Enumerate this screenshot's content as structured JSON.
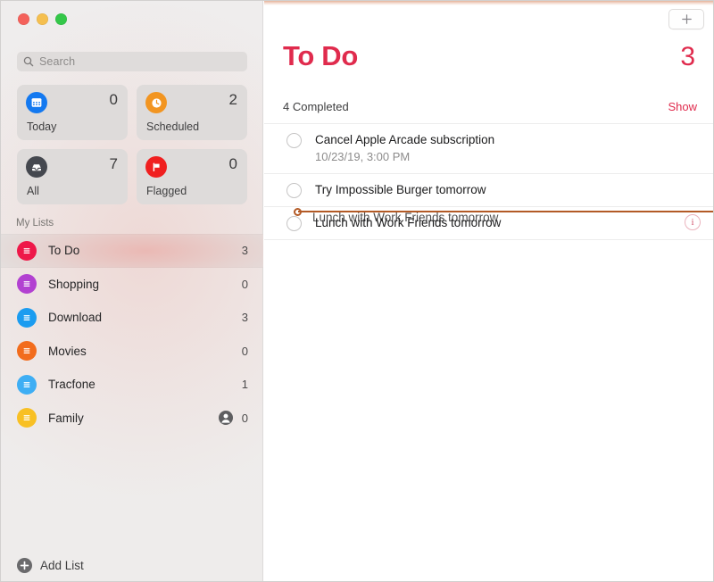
{
  "window": {
    "traffic_lights": [
      {
        "name": "close",
        "color": "#f4615b"
      },
      {
        "name": "minimize",
        "color": "#f5bf4f"
      },
      {
        "name": "zoom",
        "color": "#34c749"
      }
    ]
  },
  "sidebar": {
    "search": {
      "placeholder": "Search",
      "value": "",
      "icon": "search-icon"
    },
    "smart_lists": [
      {
        "label": "Today",
        "count": "0",
        "icon": "calendar-icon",
        "color": "#1479f0"
      },
      {
        "label": "Scheduled",
        "count": "2",
        "icon": "clock-icon",
        "color": "#f29521"
      },
      {
        "label": "All",
        "count": "7",
        "icon": "inbox-icon",
        "color": "#45484f"
      },
      {
        "label": "Flagged",
        "count": "0",
        "icon": "flag-icon",
        "color": "#f01f1f"
      }
    ],
    "my_lists_header": "My Lists",
    "lists": [
      {
        "label": "To Do",
        "count": "3",
        "color": "#ee1849",
        "selected": true,
        "shared": false
      },
      {
        "label": "Shopping",
        "count": "0",
        "color": "#b241d1",
        "selected": false,
        "shared": false
      },
      {
        "label": "Download",
        "count": "3",
        "color": "#1b9cf0",
        "selected": false,
        "shared": false
      },
      {
        "label": "Movies",
        "count": "0",
        "color": "#f26c1c",
        "selected": false,
        "shared": false
      },
      {
        "label": "Tracfone",
        "count": "1",
        "color": "#3eaef4",
        "selected": false,
        "shared": false
      },
      {
        "label": "Family",
        "count": "0",
        "color": "#f8c024",
        "selected": false,
        "shared": true
      }
    ],
    "add_list_label": "Add List"
  },
  "content": {
    "add_reminder_label": "+",
    "title": "To Do",
    "title_color": "#e02b4d",
    "count": "3",
    "completed_label": "4 Completed",
    "show_completed_label": "Show",
    "reminders": [
      {
        "title": "Cancel Apple Arcade subscription",
        "subtitle": "10/23/19, 3:00 PM",
        "completed": false,
        "info_badge": ""
      },
      {
        "title": "Try Impossible Burger tomorrow",
        "subtitle": "",
        "completed": false,
        "info_badge": ""
      },
      {
        "title": "Lunch with Work Friends tomorrow",
        "subtitle": "",
        "completed": false,
        "info_badge": "i"
      }
    ],
    "drag": {
      "ghost_text": "Lunch with Work Friends tomorrow",
      "indicator_color": "#b35a26"
    }
  }
}
